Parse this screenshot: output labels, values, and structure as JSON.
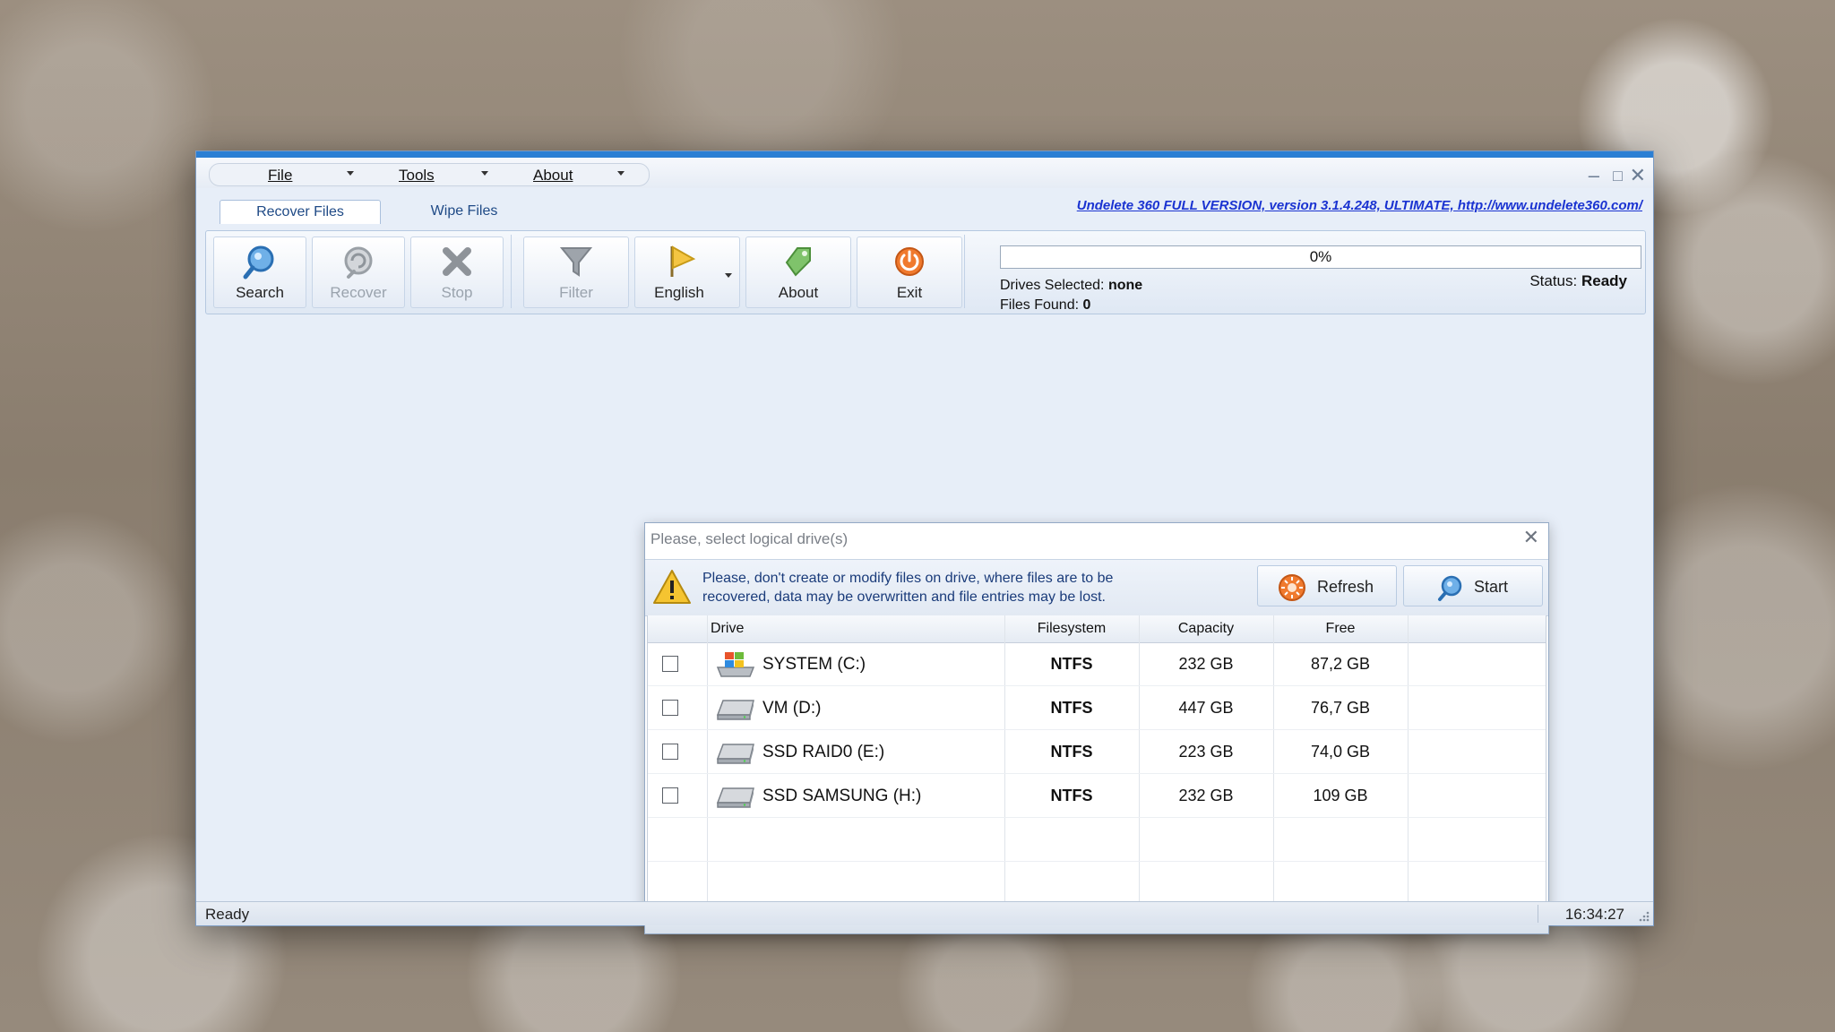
{
  "menu": {
    "items": [
      {
        "label": "File"
      },
      {
        "label": "Tools"
      },
      {
        "label": "About"
      }
    ]
  },
  "tabs": [
    {
      "label": "Recover Files",
      "active": true
    },
    {
      "label": "Wipe Files",
      "active": false
    }
  ],
  "brand_link": "Undelete 360 FULL VERSION, version 3.1.4.248, ULTIMATE, http://www.undelete360.com/",
  "toolbar": {
    "search": {
      "label": "Search",
      "icon": "search-icon",
      "enabled": true
    },
    "recover": {
      "label": "Recover",
      "icon": "recover-icon",
      "enabled": false
    },
    "stop": {
      "label": "Stop",
      "icon": "stop-icon",
      "enabled": false
    },
    "filter": {
      "label": "Filter",
      "icon": "filter-icon",
      "enabled": false
    },
    "language": {
      "label": "English",
      "icon": "flag-icon",
      "enabled": true
    },
    "about": {
      "label": "About",
      "icon": "about-icon",
      "enabled": true
    },
    "exit": {
      "label": "Exit",
      "icon": "exit-icon",
      "enabled": true
    }
  },
  "progress": {
    "value": 0,
    "text": "0%"
  },
  "info": {
    "drives_selected_label": "Drives Selected:",
    "drives_selected_value": "none",
    "files_found_label": "Files Found:",
    "files_found_value": "0",
    "status_label": "Status:",
    "status_value": "Ready"
  },
  "statusbar": {
    "left": "Ready",
    "time": "16:34:27"
  },
  "dialog": {
    "title": "Please, select logical drive(s)",
    "warning": "Please, don't create or modify files on drive, where files are to be recovered, data may be overwritten and file entries may be lost.",
    "refresh_label": "Refresh",
    "start_label": "Start",
    "columns": [
      "Drive",
      "Filesystem",
      "Capacity",
      "Free"
    ],
    "drives": [
      {
        "name": "SYSTEM (C:)",
        "filesystem": "NTFS",
        "capacity": "232 GB",
        "free": "87,2 GB",
        "checked": false,
        "icon": "system-drive-icon"
      },
      {
        "name": "VM (D:)",
        "filesystem": "NTFS",
        "capacity": "447 GB",
        "free": "76,7 GB",
        "checked": false,
        "icon": "hard-drive-icon"
      },
      {
        "name": "SSD RAID0 (E:)",
        "filesystem": "NTFS",
        "capacity": "223 GB",
        "free": "74,0 GB",
        "checked": false,
        "icon": "hard-drive-icon"
      },
      {
        "name": "SSD SAMSUNG (H:)",
        "filesystem": "NTFS",
        "capacity": "232 GB",
        "free": "109 GB",
        "checked": false,
        "icon": "hard-drive-icon"
      }
    ]
  },
  "colors": {
    "accent": "#2b7fd4",
    "link": "#1a33d1",
    "warning_text": "#1a3b7a"
  }
}
